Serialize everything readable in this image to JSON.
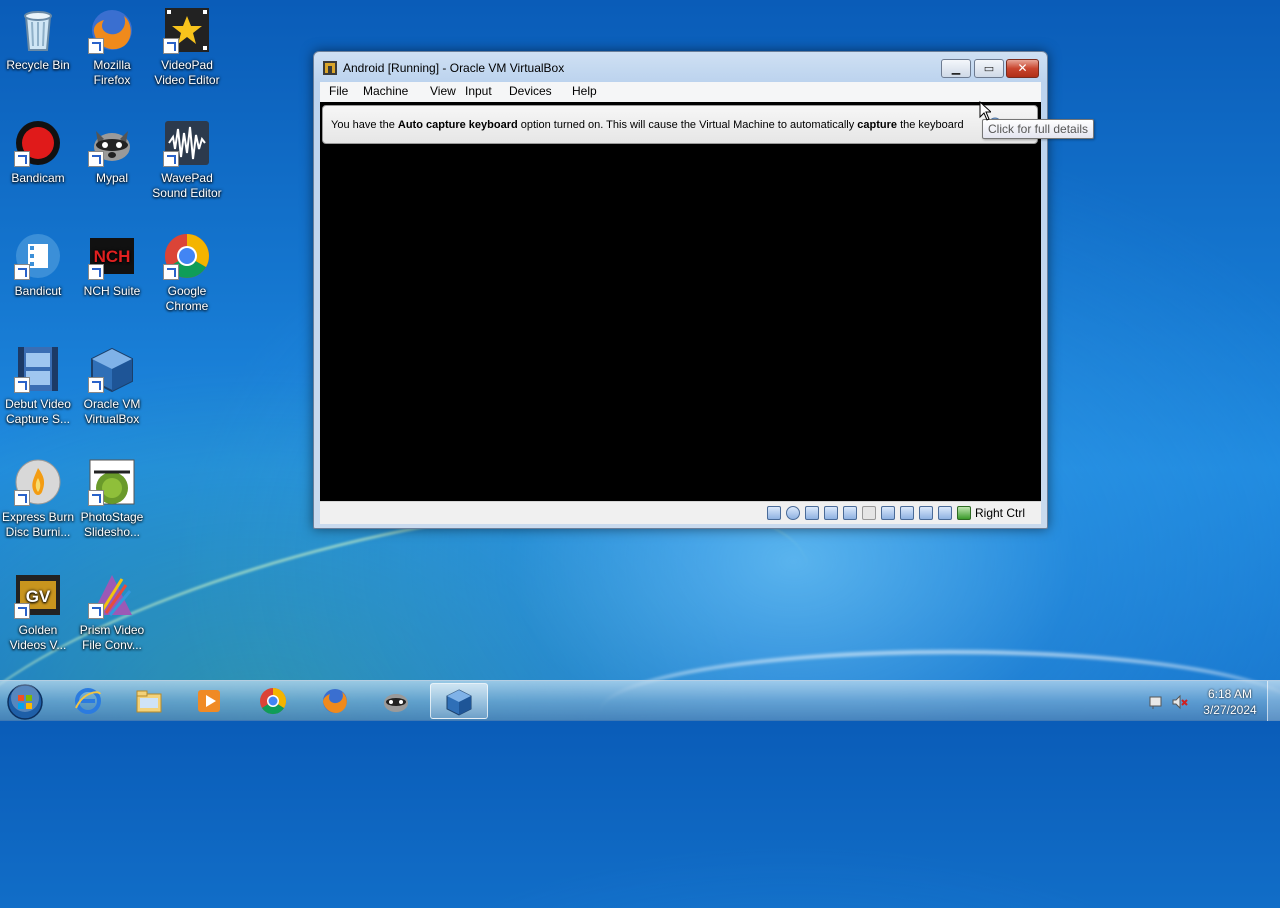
{
  "desktop": {
    "icons": [
      {
        "label": "Recycle Bin"
      },
      {
        "label": "Mozilla\nFirefox"
      },
      {
        "label": "VideoPad\nVideo Editor"
      },
      {
        "label": "Bandicam"
      },
      {
        "label": "Mypal"
      },
      {
        "label": "WavePad\nSound Editor"
      },
      {
        "label": "Bandicut"
      },
      {
        "label": "NCH Suite"
      },
      {
        "label": "Google\nChrome"
      },
      {
        "label": "Debut Video\nCapture S..."
      },
      {
        "label": "Oracle VM\nVirtualBox"
      },
      {
        "label": "Express Burn\nDisc Burni..."
      },
      {
        "label": "PhotoStage\nSlidesho..."
      },
      {
        "label": "Golden\nVideos V..."
      },
      {
        "label": "Prism Video\nFile Conv..."
      }
    ]
  },
  "window": {
    "title": "Android [Running] - Oracle VM VirtualBox",
    "menu": [
      "File",
      "Machine",
      "View",
      "Input",
      "Devices",
      "Help"
    ],
    "notice": {
      "part1": "You have the ",
      "bold1": "Auto capture keyboard",
      "part2": " option turned on. This will cause the Virtual Machine to automatically ",
      "bold2": "capture",
      "part3": " the keyboard"
    },
    "tooltip": "Click for full details",
    "host_key": "Right Ctrl"
  },
  "taskbar": {
    "time": "6:18 AM",
    "date": "3/27/2024"
  },
  "colors": {
    "desktop_bg": "#1577d0",
    "vm_screen": "#000000",
    "close_button": "#c9452e"
  }
}
